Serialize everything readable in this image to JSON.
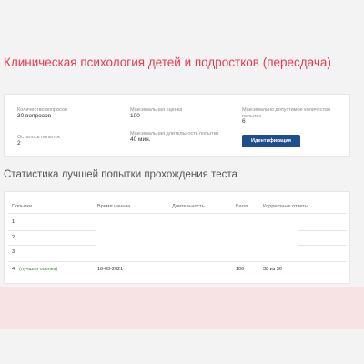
{
  "page": {
    "title": "Клиническая психология детей и подростков (пересдача)"
  },
  "info": {
    "question_count_label": "Количество вопросов",
    "question_count_value": "30 вопросов",
    "max_score_label": "Максимальная оценка",
    "max_score_value": "100",
    "max_attempts_label": "Максимально допустимое количество попыток",
    "max_attempts_value": "6",
    "attempts_left_label": "Осталось попыток",
    "attempts_left_value": "2",
    "max_duration_label": "Максимальная длительность попытки",
    "max_duration_value": "40 мин.",
    "identify_button": "Идентификация"
  },
  "stats": {
    "title": "Статистика лучшей попытки прохождения теста",
    "columns": [
      "Попытки",
      "Время начала",
      "Длительность",
      "Балл",
      "Корректные ответы"
    ],
    "rows": [
      {
        "attempt": "1",
        "note": "",
        "start": "",
        "duration": "",
        "score": "",
        "correct": ""
      },
      {
        "attempt": "2",
        "note": "",
        "start": "",
        "duration": "",
        "score": "",
        "correct": ""
      },
      {
        "attempt": "3",
        "note": "",
        "start": "",
        "duration": "",
        "score": "",
        "correct": ""
      },
      {
        "attempt": "4",
        "note": "(лучшая оценка)",
        "start": "16-03-2021",
        "duration": "",
        "score": "100",
        "correct": "30 из 30"
      }
    ]
  },
  "colors": {
    "title": "#e8394d",
    "button": "#1f4e8c",
    "best_note": "#3a8f3a"
  }
}
